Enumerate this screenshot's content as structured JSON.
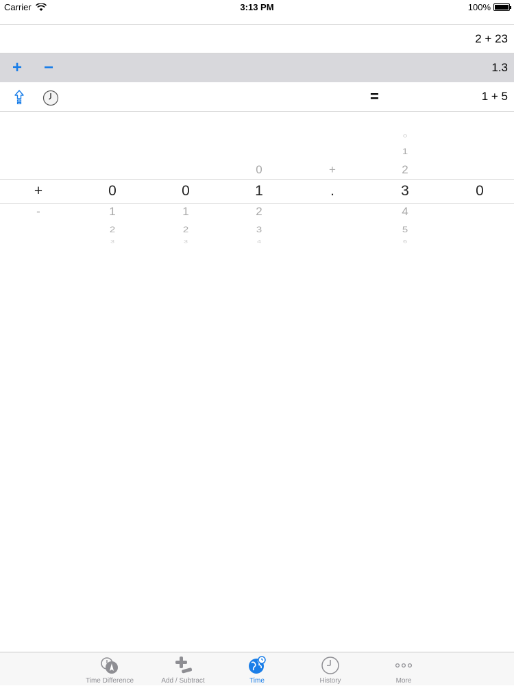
{
  "status_bar": {
    "carrier": "Carrier",
    "time": "3:13 PM",
    "battery": "100%"
  },
  "rows": {
    "row1_value": "2 + 23",
    "row2_value": "1.3",
    "row3_value": "1 + 5",
    "plus_label": "+",
    "minus_label": "−",
    "equals_label": "="
  },
  "picker": {
    "columns": [
      {
        "above": [
          "",
          "",
          ""
        ],
        "selected": "+",
        "below": [
          "-",
          "",
          ""
        ]
      },
      {
        "above": [
          "",
          "",
          ""
        ],
        "selected": "0",
        "below": [
          "1",
          "2",
          "3"
        ]
      },
      {
        "above": [
          "",
          "",
          ""
        ],
        "selected": "0",
        "below": [
          "1",
          "2",
          "3"
        ]
      },
      {
        "above": [
          "",
          "",
          "0"
        ],
        "selected": "1",
        "below": [
          "2",
          "3",
          "4"
        ]
      },
      {
        "above": [
          "",
          "",
          "+"
        ],
        "selected": ".",
        "below": [
          "",
          "",
          ""
        ]
      },
      {
        "above": [
          "0",
          "1",
          "2"
        ],
        "selected": "3",
        "below": [
          "4",
          "5",
          "6"
        ]
      },
      {
        "above": [
          "",
          "",
          ""
        ],
        "selected": "0",
        "below": [
          "",
          "",
          ""
        ]
      }
    ]
  },
  "tabs": [
    {
      "label": "Time Difference",
      "icon": "time-difference-icon"
    },
    {
      "label": "Add / Subtract",
      "icon": "add-subtract-icon"
    },
    {
      "label": "Time",
      "icon": "time-globe-icon",
      "active": true
    },
    {
      "label": "History",
      "icon": "history-clock-icon"
    },
    {
      "label": "More",
      "icon": "more-dots-icon"
    }
  ],
  "colors": {
    "accent": "#1a7ee8",
    "highlight_row": "#d8d8dc",
    "inactive_tab": "#8e8e93"
  }
}
